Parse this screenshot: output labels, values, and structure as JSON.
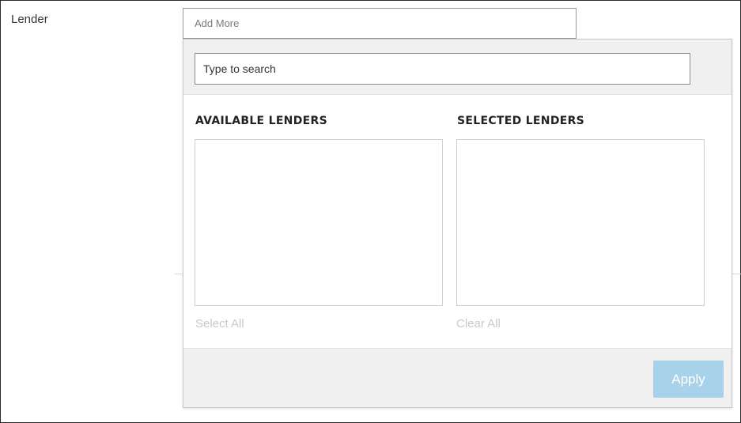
{
  "field": {
    "label": "Lender",
    "trigger_text": "Add More"
  },
  "panel": {
    "search": {
      "placeholder": "Type to search",
      "value": ""
    },
    "available": {
      "title": "AVAILABLE LENDERS",
      "items": [],
      "action_label": "Select All"
    },
    "selected": {
      "title": "SELECTED LENDERS",
      "items": [],
      "action_label": "Clear All"
    },
    "footer": {
      "apply_label": "Apply"
    }
  },
  "colors": {
    "apply_button_bg": "#a8d1ea",
    "header_footer_bg": "#f0f0f0",
    "disabled_link": "#c9c9c9"
  }
}
